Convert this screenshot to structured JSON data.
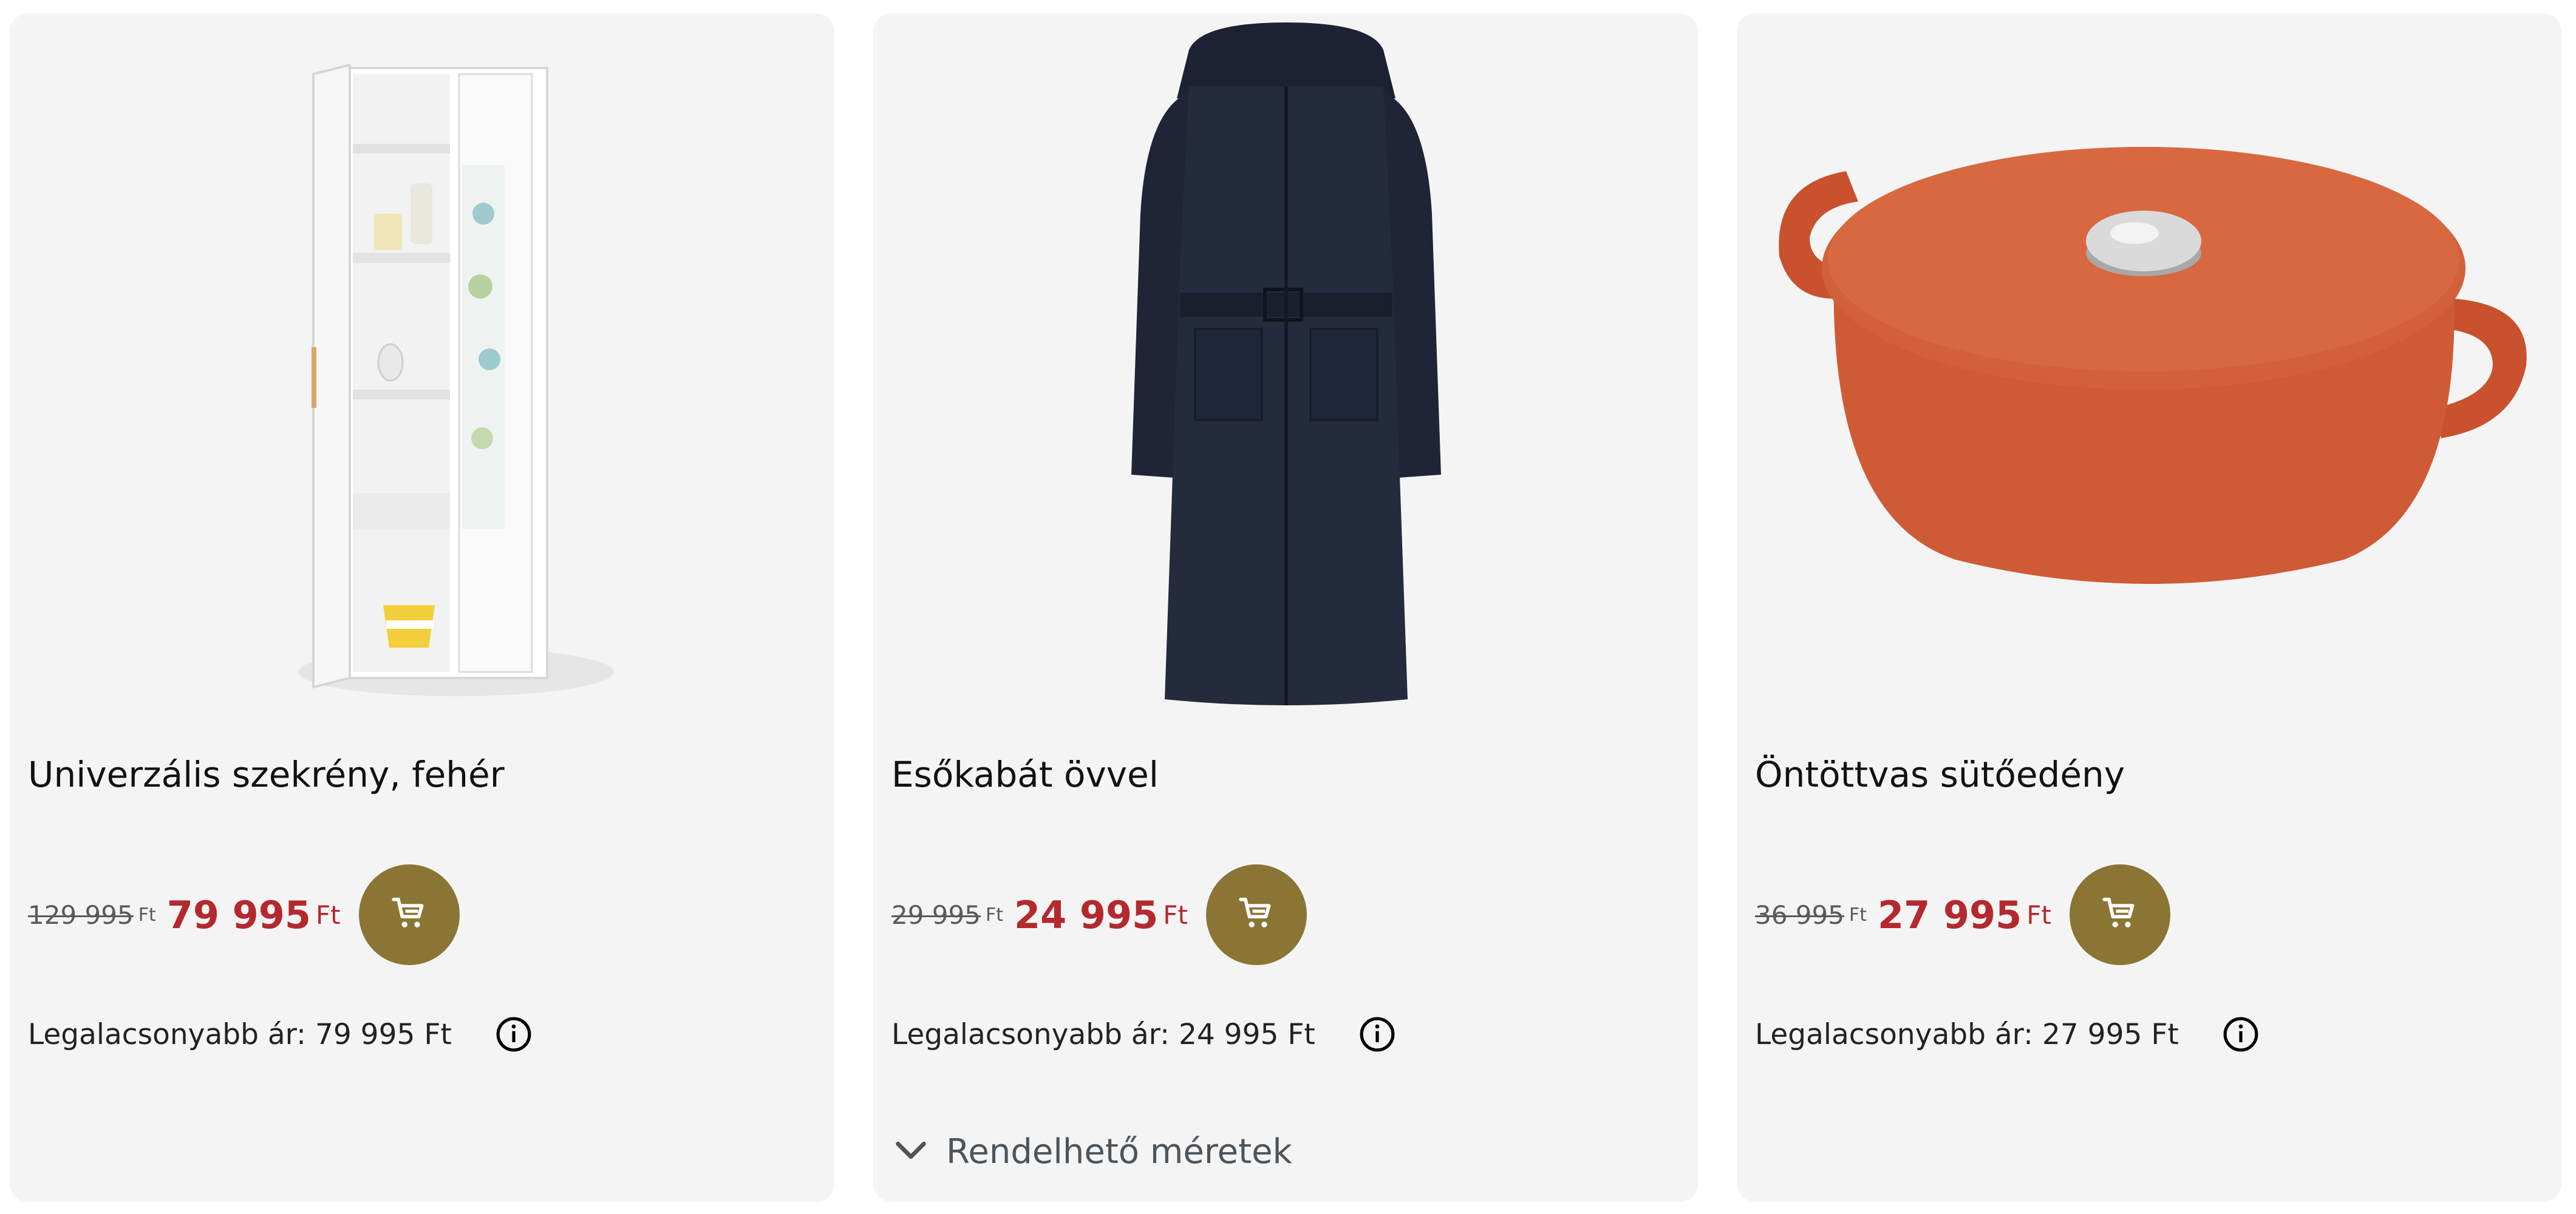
{
  "products": [
    {
      "image_alt": "Universal white cabinet",
      "title": "Univerzális szekrény, fehér",
      "old_price": "129 995",
      "old_currency": "Ft",
      "price": "79 995",
      "currency": "Ft",
      "lowest_label": "Legalacsonyabb ár: 79 995 Ft",
      "cart_icon": "cart-icon",
      "info_icon": "info-icon"
    },
    {
      "image_alt": "Navy rain coat with belt",
      "title": "Esőkabát övvel",
      "old_price": "29 995",
      "old_currency": "Ft",
      "price": "24 995",
      "currency": "Ft",
      "lowest_label": "Legalacsonyabb ár: 24 995 Ft",
      "cart_icon": "cart-icon",
      "info_icon": "info-icon",
      "sizes_label": "Rendelhető méretek",
      "sizes_icon": "chevron-down-icon"
    },
    {
      "image_alt": "Orange cast iron casserole",
      "title": "Öntöttvas sütőedény",
      "old_price": "36 995",
      "old_currency": "Ft",
      "price": "27 995",
      "currency": "Ft",
      "lowest_label": "Legalacsonyabb ár: 27 995 Ft",
      "cart_icon": "cart-icon",
      "info_icon": "info-icon"
    }
  ],
  "colors": {
    "card_bg": "#f4f4f4",
    "price_red": "#b4282e",
    "cart_button": "#8b7535",
    "sizes_text": "#4c545c"
  }
}
